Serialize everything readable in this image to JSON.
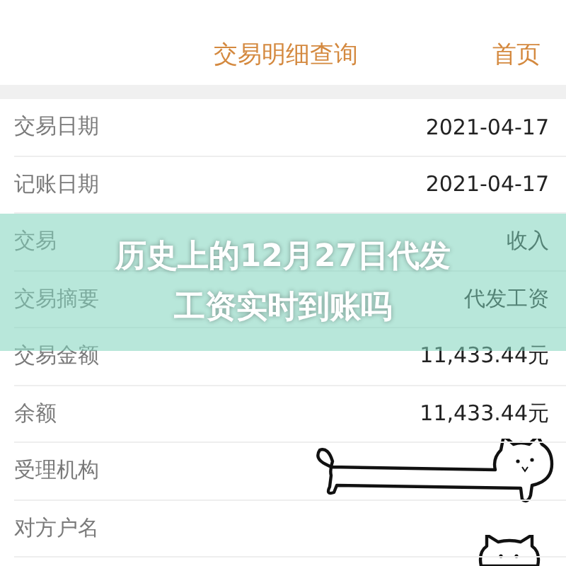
{
  "header": {
    "title": "交易明细查询",
    "home_link": "首页"
  },
  "rows": [
    {
      "label": "交易日期",
      "value": "2021-04-17"
    },
    {
      "label": "记账日期",
      "value": "2021-04-17"
    },
    {
      "label": "交易",
      "value": "收入"
    },
    {
      "label": "交易摘要",
      "value": "代发工资"
    },
    {
      "label": "交易金额",
      "value": "11,433.44元"
    },
    {
      "label": "余额",
      "value": "11,433.44元"
    },
    {
      "label": "受理机构"
    },
    {
      "label": "对方户名"
    }
  ],
  "banner": {
    "title": "历史上的12月27日代发工资实时到账吗"
  }
}
